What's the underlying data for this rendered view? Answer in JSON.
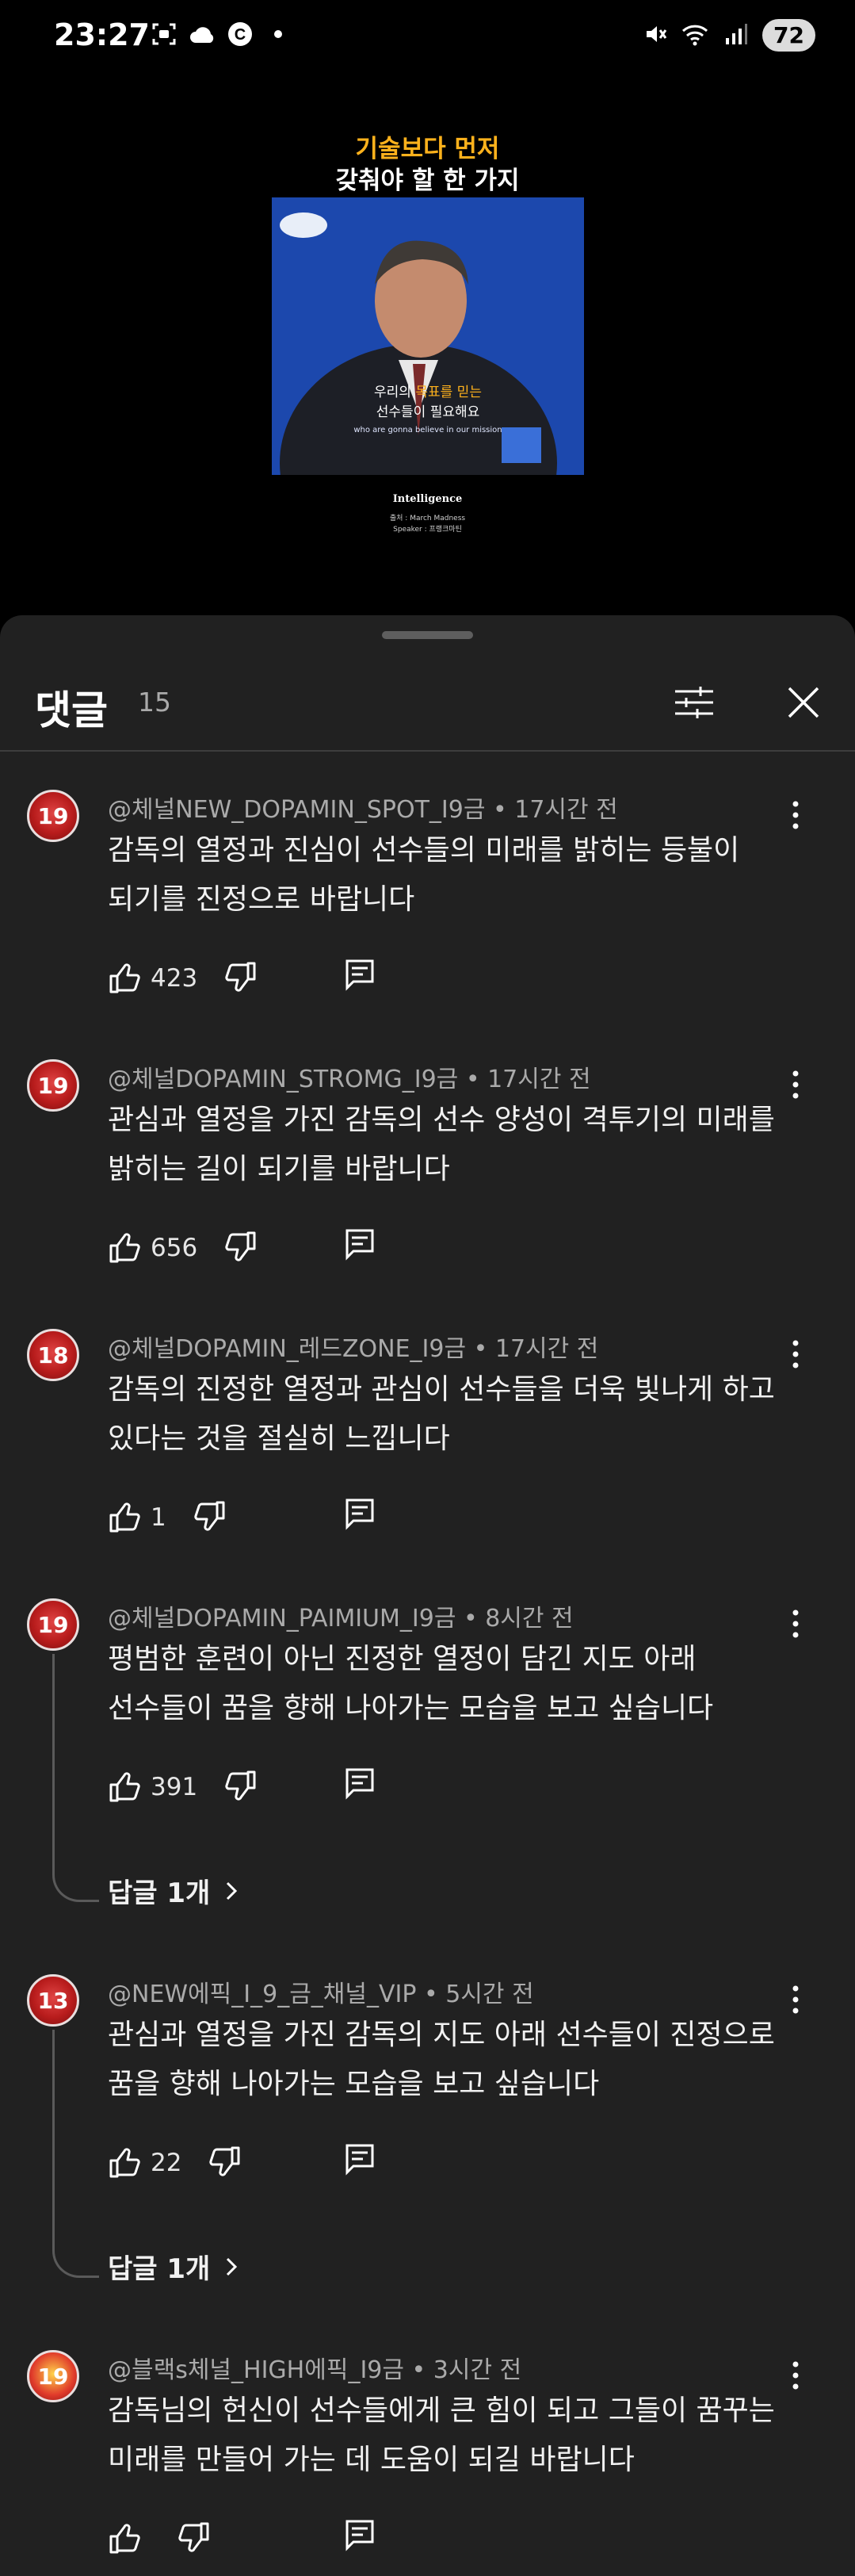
{
  "status_bar": {
    "time": "23:27",
    "left_icons": [
      "screenshot-icon",
      "cloud-icon",
      "c-badge-icon",
      "dot-icon"
    ],
    "right_icons": [
      "mute-icon",
      "wifi-icon",
      "signal-icon"
    ],
    "battery": "72"
  },
  "video": {
    "title_line1": "기술보다 먼저",
    "title_line2": "갖춰야 할 한 가지",
    "subtitle_pre": "우리의 ",
    "subtitle_highlight": "목표를 믿는",
    "subtitle_line2": "선수들이 필요해요",
    "subtitle_en": "who are gonna believe in our mission",
    "brand": "Intelligence",
    "credit1": "출처 : March Madness",
    "credit2": "Speaker : 프랭크마틴"
  },
  "comments_panel": {
    "title": "댓글",
    "count": "15",
    "filter_icon": "sliders-icon",
    "close_icon": "close-icon",
    "comments": [
      {
        "author": "@체널NEW_DOPAMIN_SPOT_I9금",
        "time": "17시간 전",
        "text_line1": "감독의 열정과 진심이 선수들의 미래를 밝히는 등불이",
        "text_line2": "되기를 진정으로 바랍니다",
        "likes": "423",
        "avatar_label": "19"
      },
      {
        "author": "@체널DOPAMIN_STROMG_I9금",
        "time": "17시간 전",
        "text_line1": "관심과 열정을 가진 감독의 선수 양성이 격투기의 미래를",
        "text_line2": "밝히는 길이 되기를 바랍니다",
        "likes": "656",
        "avatar_label": "19"
      },
      {
        "author": "@체널DOPAMIN_레드ZONE_I9금",
        "time": "17시간 전",
        "text_line1": "감독의 진정한 열정과 관심이 선수들을 더욱 빛나게 하고",
        "text_line2": "있다는 것을 절실히 느낍니다",
        "likes": "1",
        "avatar_label": "18"
      },
      {
        "author": "@체널DOPAMIN_PAIMIUM_I9금",
        "time": "8시간 전",
        "text_line1": "평범한 훈련이 아닌 진정한 열정이 담긴 지도 아래",
        "text_line2": "선수들이 꿈을 향해 나아가는 모습을 보고 싶습니다",
        "likes": "391",
        "replies": "답글 1개",
        "avatar_label": "19"
      },
      {
        "author": "@NEW에픽_I_9_금_채널_VIP",
        "time": "5시간 전",
        "text_line1": "관심과 열정을 가진 감독의 지도 아래 선수들이 진정으로",
        "text_line2": "꿈을 향해 나아가는 모습을 보고 싶습니다",
        "likes": "22",
        "replies": "답글 1개",
        "avatar_label": "13"
      },
      {
        "author": "@블랙s체널_HIGH에픽_I9금",
        "time": "3시간 전",
        "text_line1": "감독님의 헌신이 선수들에게 큰 힘이 되고 그들이 꿈꾸는",
        "text_line2": "미래를 만들어 가는 데 도움이 되길 바랍니다",
        "likes": "",
        "avatar_label": "19"
      }
    ]
  }
}
